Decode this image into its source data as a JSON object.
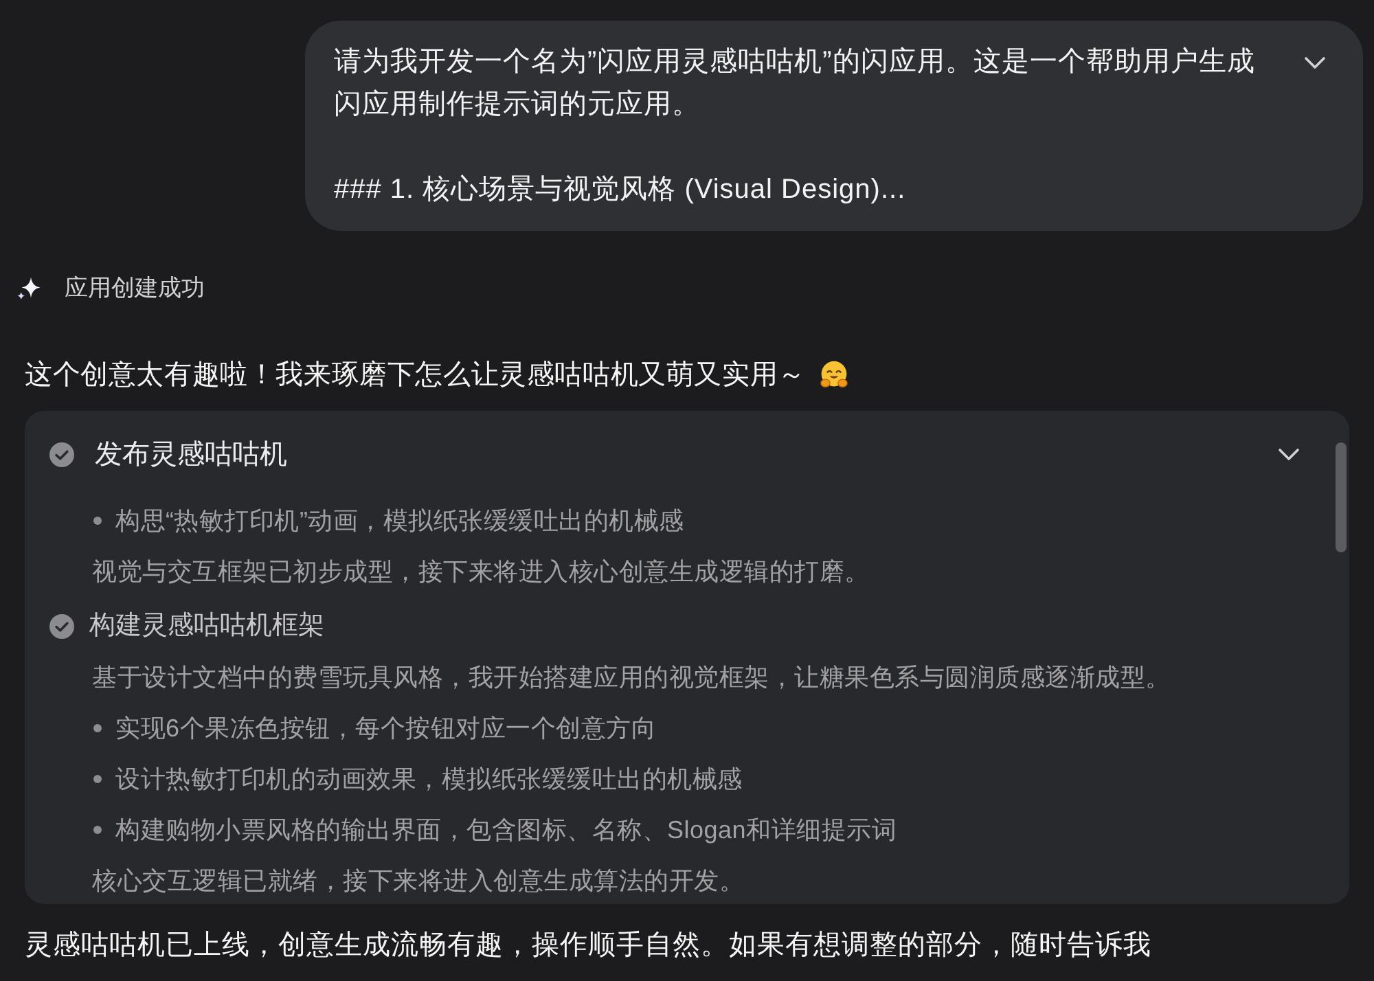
{
  "user_message": {
    "paragraphs": [
      "请为我开发一个名为”闪应用灵感咕咕机”的闪应用。这是一个帮助用户生成闪应用制作提示词的元应用。",
      "### 1. 核心场景与视觉风格 (Visual Design)..."
    ],
    "expanded": false
  },
  "status": {
    "text": "应用创建成功"
  },
  "reply": {
    "text": "这个创意太有趣啦！我来琢磨下怎么让灵感咕咕机又萌又实用～"
  },
  "progress_card": {
    "title": "发布灵感咕咕机",
    "done": true,
    "expanded": true,
    "blocks": [
      {
        "kind": "bullet",
        "text": "构思“热敏打印机”动画，模拟纸张缓缓吐出的机械感"
      },
      {
        "kind": "note",
        "text": "视觉与交互框架已初步成型，接下来将进入核心创意生成逻辑的打磨。"
      },
      {
        "kind": "step",
        "text": "构建灵感咕咕机框架",
        "done": true
      },
      {
        "kind": "note",
        "text": "基于设计文档中的费雪玩具风格，我开始搭建应用的视觉框架，让糖果色系与圆润质感逐渐成型。"
      },
      {
        "kind": "bullet",
        "text": "实现6个果冻色按钮，每个按钮对应一个创意方向"
      },
      {
        "kind": "bullet",
        "text": "设计热敏打印机的动画效果，模拟纸张缓缓吐出的机械感"
      },
      {
        "kind": "bullet",
        "text": "构建购物小票风格的输出界面，包含图标、名称、Slogan和详细提示词"
      },
      {
        "kind": "note",
        "text": "核心交互逻辑已就绪，接下来将进入创意生成算法的开发。"
      }
    ]
  },
  "closing": {
    "text": "灵感咕咕机已上线，创意生成流畅有趣，操作顺手自然。如果有想调整的部分，随时告诉我"
  }
}
